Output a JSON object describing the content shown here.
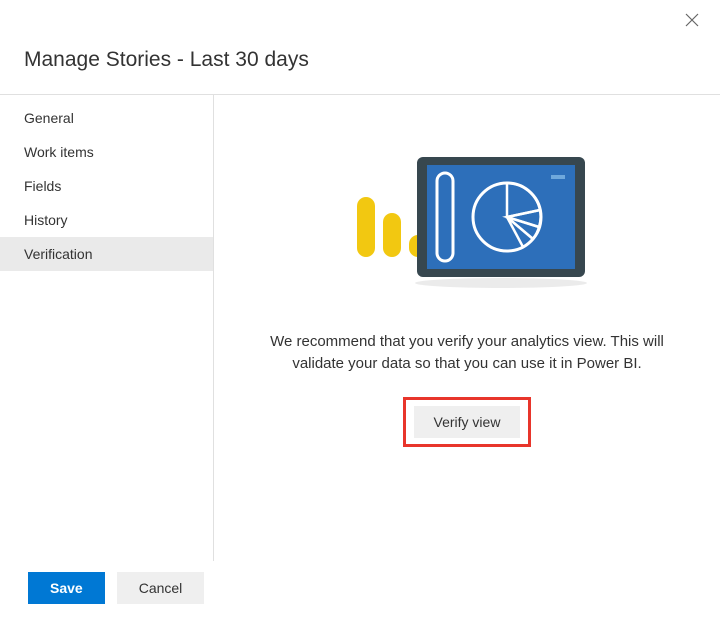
{
  "header": {
    "title": "Manage Stories - Last 30 days"
  },
  "sidebar": {
    "items": [
      {
        "label": "General",
        "active": false
      },
      {
        "label": "Work items",
        "active": false
      },
      {
        "label": "Fields",
        "active": false
      },
      {
        "label": "History",
        "active": false
      },
      {
        "label": "Verification",
        "active": true
      }
    ]
  },
  "main": {
    "recommend_text": "We recommend that you verify your analytics view. This will validate your data so that you can use it in Power BI.",
    "verify_label": "Verify view"
  },
  "footer": {
    "save_label": "Save",
    "cancel_label": "Cancel"
  },
  "icons": {
    "close": "close-icon",
    "illustration": "analytics-tablet-illustration"
  },
  "colors": {
    "primary": "#0078d4",
    "highlight_border": "#e8352b",
    "bar_yellow": "#f2c811",
    "tablet_frame": "#37474f",
    "tablet_screen": "#2d6fba"
  }
}
